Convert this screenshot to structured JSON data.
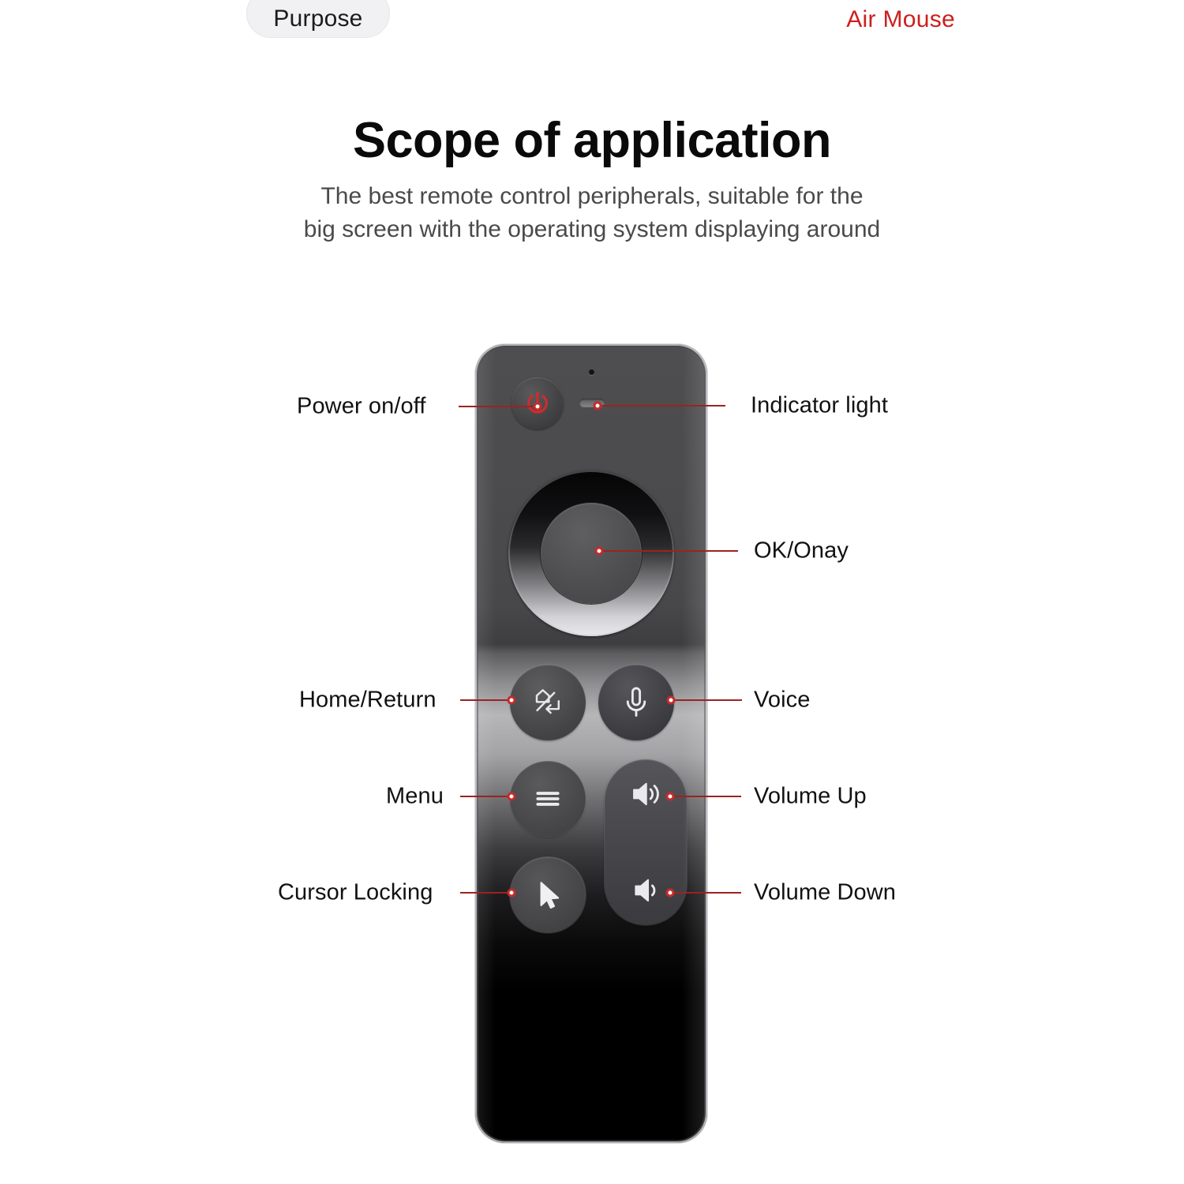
{
  "header": {
    "badge_label": "Purpose",
    "brand_label": "Air Mouse",
    "brand_color": "#cc1f1f"
  },
  "hero": {
    "title": "Scope of application",
    "subtitle_line1": "The best remote control peripherals, suitable for the",
    "subtitle_line2": "big screen with the operating system displaying around"
  },
  "device": {
    "name": "air-mouse-remote",
    "leader_color": "#9c2222",
    "dot_color": "#c42b2b"
  },
  "callouts": {
    "left": [
      {
        "label": "Power on/off",
        "icon": "power-icon"
      },
      {
        "label": "Home/Return",
        "icon": "home-return-icon"
      },
      {
        "label": "Menu",
        "icon": "menu-icon"
      },
      {
        "label": "Cursor Locking",
        "icon": "cursor-pointer-icon"
      }
    ],
    "right": [
      {
        "label": "Indicator light",
        "icon": "indicator-light-icon"
      },
      {
        "label": "OK/Onay",
        "icon": "ok-button-icon"
      },
      {
        "label": "Voice",
        "icon": "microphone-icon"
      },
      {
        "label": "Volume Up",
        "icon": "volume-up-icon"
      },
      {
        "label": "Volume Down",
        "icon": "volume-down-icon"
      }
    ]
  }
}
